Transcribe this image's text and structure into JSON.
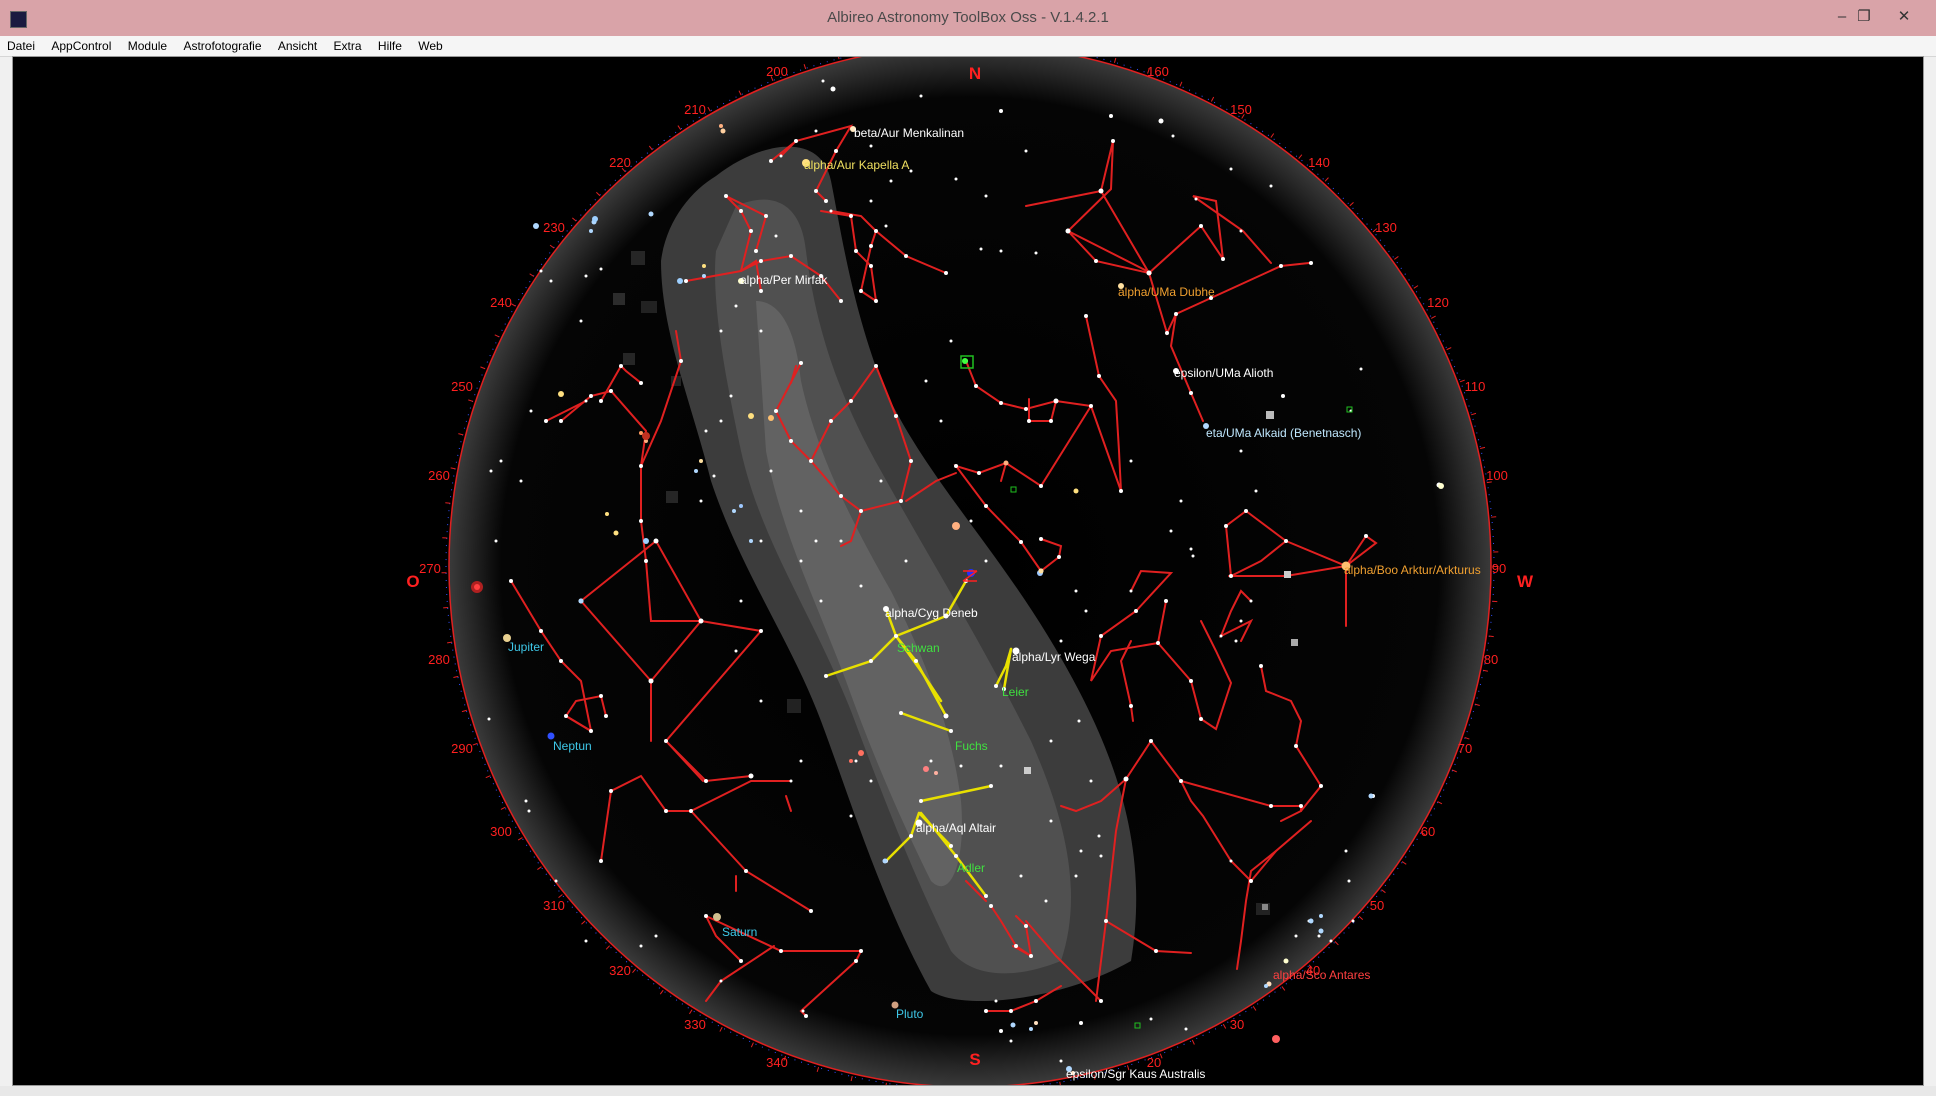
{
  "window": {
    "title": "Albireo Astronomy ToolBox Oss - V.1.4.2.1",
    "minimize_glyph": "–",
    "maximize_glyph": "❐",
    "close_glyph": "✕"
  },
  "menu": [
    "Datei",
    "AppControl",
    "Module",
    "Astrofotografie",
    "Ansicht",
    "Extra",
    "Hilfe",
    "Web"
  ],
  "colors": {
    "sky": "#000000",
    "horizon_ring": "#333333",
    "constellation_line": "#e02020",
    "highlight_line": "#e8e000",
    "milky_way": "#555555",
    "star_label": "#ffffff",
    "bright_star_label": "#f0a030",
    "planet_label": "#3ec8e8",
    "constellation_label": "#40e040",
    "scale": "#ff2020"
  },
  "cardinals": {
    "north": "N",
    "south": "S",
    "east": "O",
    "west": "W"
  },
  "azimuth_labels": [
    "20",
    "30",
    "40",
    "50",
    "60",
    "70",
    "80",
    "90",
    "100",
    "110",
    "120",
    "130",
    "140",
    "150",
    "160",
    "200",
    "210",
    "220",
    "230",
    "240",
    "250",
    "260",
    "270",
    "280",
    "290",
    "300",
    "310",
    "320",
    "330",
    "340"
  ],
  "star_labels": {
    "menkalinan": "beta/Aur Menkalinan",
    "kapella": "alpha/Aur Kapella A",
    "mirfak": "alpha/Per Mirfak",
    "dubhe": "alpha/UMa Dubhe",
    "alioth": "epsilon/UMa Alioth",
    "alkaid": "eta/UMa Alkaid (Benetnasch)",
    "arktur": "alpha/Boo Arktur/Arkturus",
    "deneb": "alpha/Cyg Deneb",
    "wega": "alpha/Lyr Wega",
    "altair": "alpha/Aql Altair",
    "antares": "alpha/Sco Antares",
    "kaus": "epsilon/Sgr Kaus Australis"
  },
  "planets": {
    "jupiter": "Jupiter",
    "neptun": "Neptun",
    "saturn": "Saturn",
    "pluto": "Pluto"
  },
  "constellations": {
    "schwan": "Schwan",
    "leier": "Leier",
    "fuchs": "Fuchs",
    "adler": "Adler"
  }
}
